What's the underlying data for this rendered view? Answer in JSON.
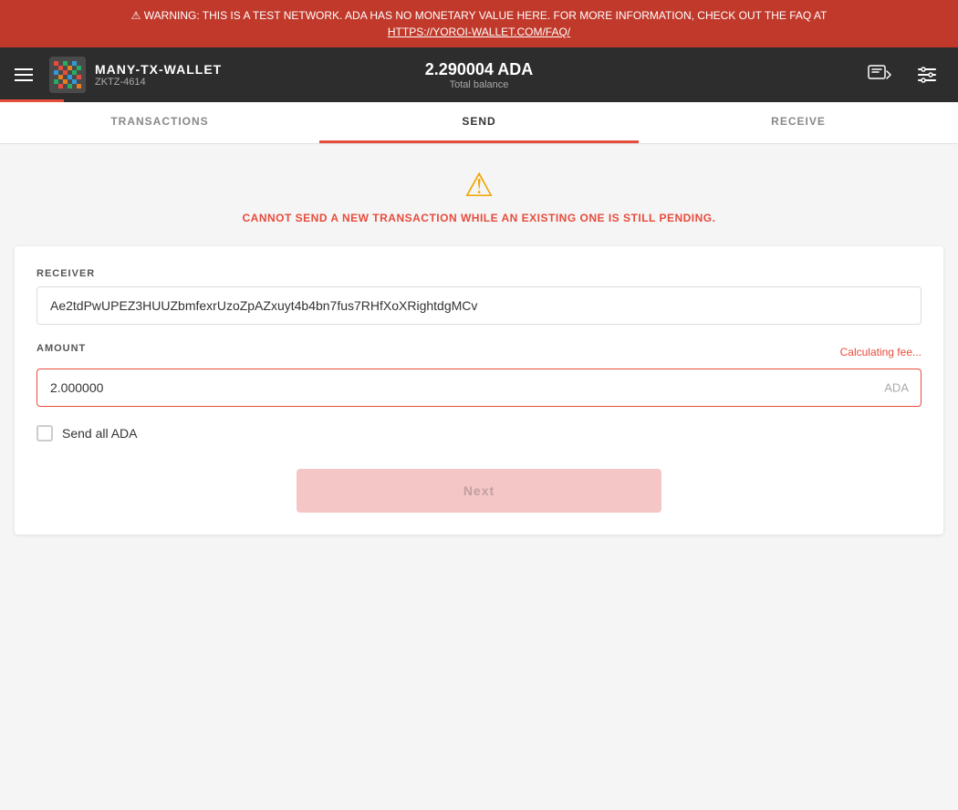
{
  "warning": {
    "text": "WARNING: THIS IS A TEST NETWORK. ADA HAS NO MONETARY VALUE HERE. FOR MORE INFORMATION, CHECK OUT THE FAQ AT",
    "link_text": "HTTPS://YOROI-WALLET.COM/FAQ/",
    "link_href": "https://yoroi-wallet.com/faq/"
  },
  "header": {
    "wallet_name": "MANY-TX-WALLET",
    "wallet_id": "ZKTZ-4614",
    "balance": "2.290004 ADA",
    "balance_label": "Total balance"
  },
  "nav": {
    "tabs": [
      {
        "label": "TRANSACTIONS",
        "active": false
      },
      {
        "label": "SEND",
        "active": true
      },
      {
        "label": "RECEIVE",
        "active": false
      }
    ]
  },
  "send_form": {
    "error_message": "CANNOT SEND A NEW TRANSACTION WHILE AN EXISTING ONE IS STILL PENDING.",
    "receiver_label": "RECEIVER",
    "receiver_value": "Ae2tdPwUPEZ3HUUZbmfexrUzoZpAZxuyt4b4bn7fus7RHfXoXRightdgMCv",
    "amount_label": "AMOUNT",
    "calculating_fee": "Calculating fee...",
    "amount_value": "2.000000",
    "amount_unit": "ADA",
    "send_all_label": "Send all ADA",
    "next_button_label": "Next"
  }
}
